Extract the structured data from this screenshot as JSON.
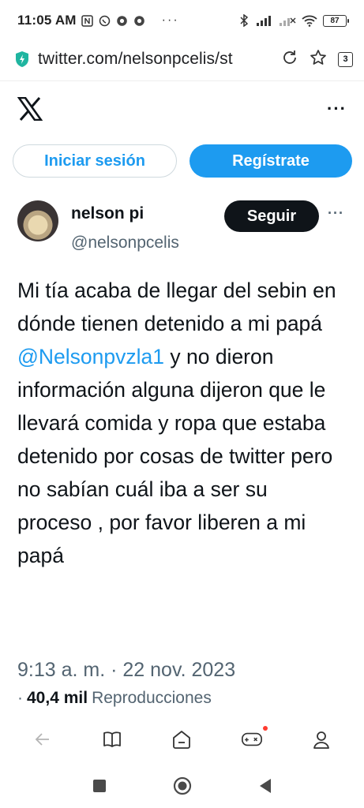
{
  "status_bar": {
    "time": "11:05 AM",
    "more_indicator": "···",
    "battery": "87"
  },
  "browser": {
    "url": "twitter.com/nelsonpcelis/st",
    "tab_count": "3"
  },
  "auth": {
    "login_label": "Iniciar sesión",
    "signup_label": "Regístrate"
  },
  "tweet": {
    "author_name": "nelson pi",
    "author_handle": "@nelsonpcelis",
    "follow_label": "Seguir",
    "more_label": "···",
    "text_before": "Mi tía acaba de llegar del sebin en dónde tienen detenido a mi papá ",
    "mention": "@Nelsonpvzla1",
    "text_after": " y no dieron información alguna dijeron que le llevará comida y ropa que estaba detenido por cosas de twitter pero no sabían cuál iba a ser su proceso , por favor liberen a mi papá",
    "timestamp": "9:13 a. m. · 22 nov. 2023",
    "views_prefix": "·",
    "views_count": "40,4 mil",
    "views_label": "Reproducciones"
  },
  "header": {
    "more_label": "···"
  },
  "icons": {
    "brand_color": "#1d9bf0",
    "text_color": "#0f1419",
    "secondary_color": "#536471"
  }
}
